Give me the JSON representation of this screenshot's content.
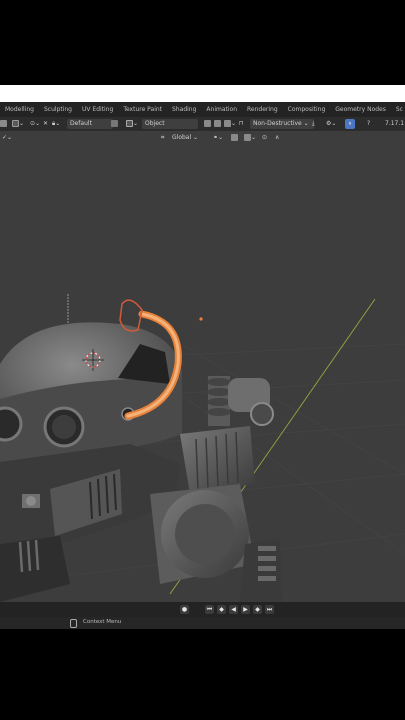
{
  "workspace_tabs": [
    "Modelling",
    "Sculpting",
    "UV Editing",
    "Texture Paint",
    "Shading",
    "Animation",
    "Rendering",
    "Compositing",
    "Geometry Nodes",
    "Sc"
  ],
  "header": {
    "mode_label": "Default",
    "object_label": "Object",
    "non_destructive_label": "Non-Destructive",
    "version": "7.17.1"
  },
  "tool_bar2": {
    "orientation_label": "Global"
  },
  "status_bar": {
    "context_menu_label": "Context Menu"
  },
  "colors": {
    "viewport_bg": "#3d3d3d",
    "selection_outline": "#e8823a",
    "grid_axis": "#9aa640",
    "active_toggle": "#4d77c4"
  }
}
